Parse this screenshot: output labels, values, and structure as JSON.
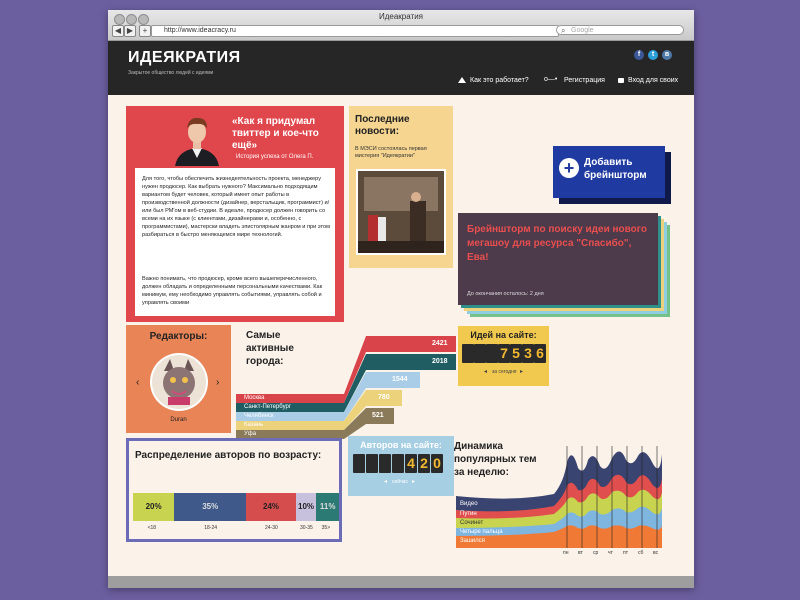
{
  "browser": {
    "window_title": "Идеакратия",
    "url": "http://www.ideacracy.ru",
    "search_placeholder": "Google"
  },
  "header": {
    "logo_text": "ИДЕЯКРАТИЯ",
    "tagline": "Закрытое общество людей с идеями",
    "nav": {
      "how_it_works": "Как это работает?",
      "register": "Регистрация",
      "login": "Вход для своих"
    },
    "social": [
      "facebook-icon",
      "twitter-icon",
      "vkontakte-icon"
    ]
  },
  "story": {
    "title": "«Как я придумал твиттер и кое-что ещё»",
    "subtitle": "История успеха от Олега П.",
    "paragraph1": "Для того, чтобы обеспечить жизнедеятельность проекта, менеджеру нужен продюсер. Как выбрать нужного? Максимально подходящим вариантом будет человек, который имеет опыт работы в производственной должности (дизайнер, верстальщик, программист) и/или был РМ'ом в веб-студии. В идеале, продюсер должен говорить со всеми на их языке (с клиентами, дизайнерами и, особенно, с программистами), мастерски владеть эпистолярным жанром и при этом разбираться в быстро меняющемся мире технологий.",
    "paragraph2": "Важно понимать, что продюсер, кроме всего вышеперечисленного, должен обладать и определенными персональными качествами. Как минимум, ему необходимо управлять событиями, управлять собой и управлять своими"
  },
  "news": {
    "title": "Последние новости:",
    "text": "В МЭСИ состоялась первая мистерия \"Идеякратии\""
  },
  "add_brainstorm": {
    "label": "Добавить брейншторм"
  },
  "brainstorm": {
    "title": "Брейншторм по поиску идеи нового мегашоу для ресурса \"Спасибо\", Ева!",
    "time_left": "До окончания осталось: 2 дня"
  },
  "editors": {
    "title": "Редакторы:",
    "name": "Duran"
  },
  "cities": {
    "title": "Самые активные города:",
    "names": [
      "Москва",
      "Санкт-Петербург",
      "Челябинск",
      "Казань",
      "Уфа"
    ],
    "values": [
      2421,
      2018,
      1544,
      780,
      521
    ],
    "colors": [
      "#d9434a",
      "#1f5d63",
      "#a9cde6",
      "#ecd27a",
      "#8a7a5a"
    ]
  },
  "ideas_counter": {
    "title": "Идей на сайте:",
    "digits": [
      "",
      "",
      "",
      "7",
      "5",
      "3",
      "6"
    ],
    "period": "за сегодня"
  },
  "authors_counter": {
    "title": "Авторов на сайте:",
    "digits": [
      "",
      "",
      "",
      "",
      "4",
      "2",
      "0"
    ],
    "period": "сейчас"
  },
  "age": {
    "title": "Распределение авторов по возрасту:",
    "chart_data": {
      "type": "bar",
      "categories": [
        "<18",
        "18-24",
        "24-30",
        "30-35",
        "35>"
      ],
      "values": [
        20,
        35,
        24,
        10,
        11
      ],
      "labels": [
        "20%",
        "35%",
        "24%",
        "10%",
        "11%"
      ],
      "colors": [
        "#c8d44f",
        "#3f5a8a",
        "#d64d4d",
        "#c7c1dd",
        "#2b7a73"
      ]
    }
  },
  "topics": {
    "title": "Динамика популярных тем за неделю:",
    "legend": [
      "Видео",
      "Путин",
      "Сочинет",
      "Четыре пальца",
      "Зашился"
    ],
    "legend_colors": [
      "#3a4470",
      "#e04e4e",
      "#c8d44f",
      "#7fb6e0",
      "#f07a35"
    ],
    "days": [
      "пн",
      "вт",
      "ср",
      "чт",
      "пт",
      "сб",
      "вс"
    ]
  }
}
